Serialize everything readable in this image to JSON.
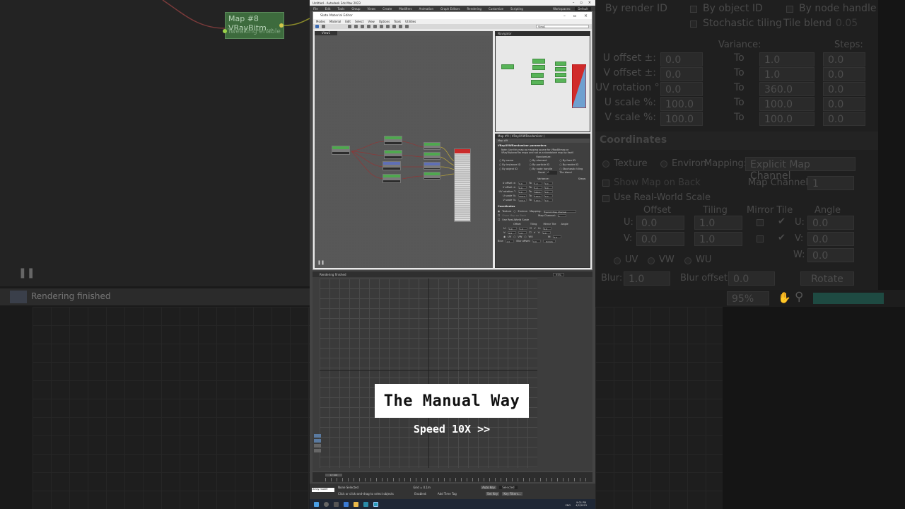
{
  "app": {
    "window_title": "Untitled - Autodesk 3ds Max 2023",
    "menu": [
      "File",
      "Edit",
      "Tools",
      "Group",
      "Views",
      "Create",
      "Modifiers",
      "Animation",
      "Graph Editors",
      "Rendering",
      "Customize",
      "Scripting"
    ],
    "workspace_label": "Workspaces:",
    "workspace_value": "Default"
  },
  "slate": {
    "title": "Slate Material Editor",
    "menu": [
      "Modes",
      "Material",
      "Edit",
      "Select",
      "View",
      "Options",
      "Tools",
      "Utilities"
    ],
    "view_dropdown": "View1",
    "view_tab": "View1",
    "navigator_title": "Navigator",
    "params_title": "Map #9  ( VRayUVWRandomizer )",
    "params_sub": "Map #9",
    "params_section": "VRayUVWRandomizer parameters",
    "params_note": "Note: Use this map as mapping source for VRayBitmap or VRayTriplanarTex maps and not as a standalone map by itself.",
    "randomize_label": "Randomize:",
    "randomize_options": [
      "By name",
      "By element",
      "By face ID",
      "By instance ID",
      "By particle ID",
      "By render ID",
      "By object ID",
      "By node handle",
      "Stochastic tiling"
    ],
    "seed_label": "Seed:",
    "seed_value": "0",
    "tile_blend_label": "Tile blend",
    "variance_label": "Variance:",
    "steps_label": "Steps:",
    "param_rows": [
      {
        "label": "U offset ±:",
        "var": "0.0",
        "to": "To",
        "to_val": "1.0",
        "steps": "0.0"
      },
      {
        "label": "V offset ±:",
        "var": "0.0",
        "to": "To",
        "to_val": "1.0",
        "steps": "0.0"
      },
      {
        "label": "UV rotation °:",
        "var": "0.0",
        "to": "To",
        "to_val": "360.0",
        "steps": "0.0"
      },
      {
        "label": "U scale %:",
        "var": "100.0",
        "to": "To",
        "to_val": "100.0",
        "steps": "0.0"
      },
      {
        "label": "V scale %:",
        "var": "100.0",
        "to": "To",
        "to_val": "100.0",
        "steps": "0.0"
      }
    ],
    "coordinates_section": "Coordinates",
    "texture_label": "Texture",
    "environ_label": "Environ",
    "mapping_label": "Mapping:",
    "mapping_value": "Explicit Map Channel",
    "show_map_on_back": "Show Map on Back",
    "map_channel_label": "Map Channel:",
    "map_channel_value": "1",
    "use_real_world": "Use Real-World Scale",
    "offset_label": "Offset",
    "tiling_label": "Tiling",
    "mirror_tile_label": "Mirror Tile",
    "angle_label": "Angle",
    "u_label": "U:",
    "v_label": "V:",
    "w_label": "W:",
    "u_offset": "0.0",
    "v_offset": "0.0",
    "u_tiling": "1.0",
    "v_tiling": "1.0",
    "u_angle": "0.0",
    "v_angle": "0.0",
    "w_angle": "0.0",
    "uv_label": "UV",
    "vw_label": "VW",
    "wu_label": "WU",
    "blur_label": "Blur:",
    "blur_value": "1.0",
    "blur_offset_label": "Blur offset:",
    "blur_offset_value": "0.0",
    "rotate_label": "Rotate",
    "render_status": "Rendering finished",
    "zoom_value": "95%"
  },
  "overlay": {
    "title": "The Manual Way",
    "speed": "Speed 10X >>"
  },
  "timeline": {
    "frame_slider": "0 / 100"
  },
  "statusbar": {
    "listener": "Array modifi",
    "selection": "None Selected",
    "prompt": "Click or click-and-drag to select objects",
    "grid": "Grid = 0.1m",
    "add_time_tag": "Add Time Tag",
    "enabled_label": "Enabled:",
    "auto_key": "Auto Key",
    "set_key": "Set Key",
    "selected": "Selected",
    "key_filters": "Key Filters..."
  },
  "taskbar": {
    "time": "9:01 PM",
    "date": "4/2/2023",
    "lang": "ENG"
  },
  "background_left": {
    "node_title": "Map #8",
    "node_sub": "VRayBitm...",
    "node_footer": "Tweaking enable",
    "status": "Rendering finished"
  },
  "background_right": {
    "by_render_id": "By render ID",
    "by_object_id": "By object ID",
    "by_node_handle": "By node handle",
    "stochastic_tiling": "Stochastic tiling",
    "tile_blend": "Tile blend",
    "tile_blend_value": "0.05",
    "variance": "Variance:",
    "steps": "Steps:",
    "rows": [
      {
        "label": "U offset ±:",
        "var": "0.0",
        "to": "To",
        "to_val": "1.0",
        "steps": "0.0"
      },
      {
        "label": "V offset ±:",
        "var": "0.0",
        "to": "To",
        "to_val": "1.0",
        "steps": "0.0"
      },
      {
        "label": "UV rotation °:",
        "var": "0.0",
        "to": "To",
        "to_val": "360.0",
        "steps": "0.0"
      },
      {
        "label": "U scale %:",
        "var": "100.0",
        "to": "To",
        "to_val": "100.0",
        "steps": "0.0"
      },
      {
        "label": "V scale %:",
        "var": "100.0",
        "to": "To",
        "to_val": "100.0",
        "steps": "0.0"
      }
    ],
    "coordinates": "Coordinates",
    "texture": "Texture",
    "environ": "Environ",
    "mapping": "Mapping:",
    "mapping_value": "Explicit Map Channel",
    "show_map_on_back": "Show Map on Back",
    "map_channel": "Map Channel:",
    "map_channel_value": "1",
    "use_real_world": "Use Real-World Scale",
    "offset": "Offset",
    "tiling": "Tiling",
    "mirror_tile": "Mirror Tile",
    "angle": "Angle",
    "u": "U:",
    "v": "V:",
    "w": "W:",
    "u_offset": "0.0",
    "v_offset": "0.0",
    "u_tiling": "1.0",
    "v_tiling": "1.0",
    "u_angle": "0.0",
    "v_angle": "0.0",
    "w_angle": "0.0",
    "uv": "UV",
    "vw": "VW",
    "wu": "WU",
    "blur": "Blur:",
    "blur_value": "1.0",
    "blur_offset": "Blur offset:",
    "blur_offset_value": "0.0",
    "rotate": "Rotate",
    "zoom": "95%"
  }
}
